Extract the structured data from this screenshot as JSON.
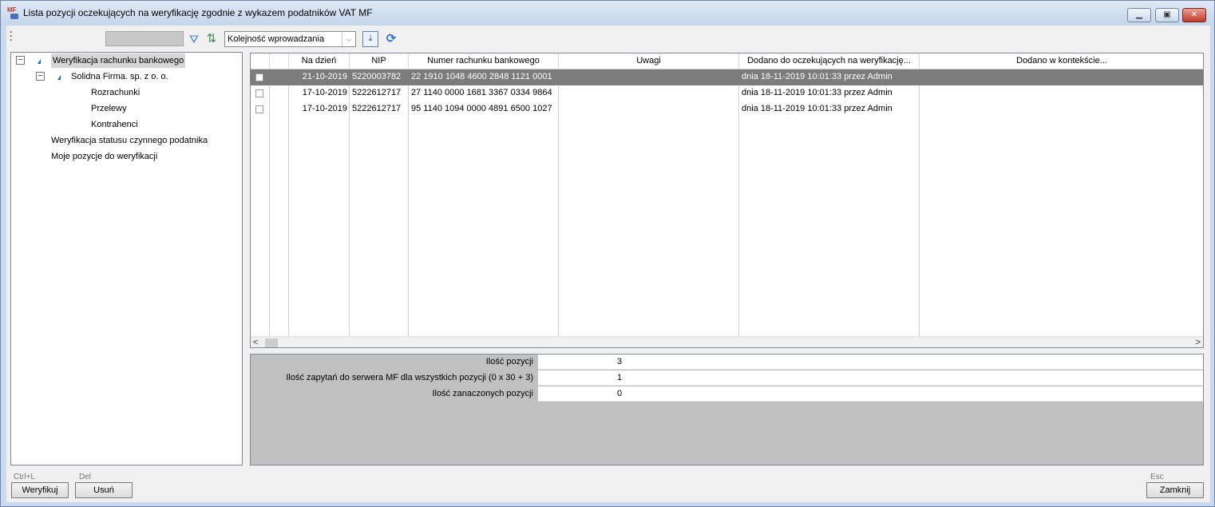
{
  "window": {
    "title": "Lista pozycji oczekujących na weryfikację zgodnie z wykazem podatników VAT MF",
    "icon_text": "MF"
  },
  "toolbar": {
    "search_value": "",
    "sort_combo_value": "Kolejność wprowadzania",
    "combo_arrow": "⌵",
    "refresh_glyph": "⟳"
  },
  "tree": {
    "items": [
      {
        "label": "Weryfikacja rachunku bankowego",
        "expander": "−",
        "selected": true
      },
      {
        "label": "Solidna Firma. sp. z o. o.",
        "expander": "−"
      },
      {
        "label": "Rozrachunki"
      },
      {
        "label": "Przelewy"
      },
      {
        "label": "Kontrahenci"
      },
      {
        "label": "Weryfikacja statusu czynnego podatnika"
      },
      {
        "label": "Moje pozycje do weryfikacji"
      }
    ]
  },
  "grid": {
    "columns": [
      "",
      "",
      "Na dzień",
      "NIP",
      "Numer rachunku bankowego",
      "Uwagi",
      "Dodano do oczekujących na weryfikację...",
      "Dodano w kontekście..."
    ],
    "rows": [
      {
        "date": "21-10-2019",
        "nip": "5220003782",
        "account": "22 1910 1048 4600 2848 1121 0001",
        "notes": "",
        "added": "dnia 18-11-2019  10:01:33 przez Admin",
        "context": "",
        "selected": true
      },
      {
        "date": "17-10-2019",
        "nip": "5222612717",
        "account": "27 1140 0000 1681 3367 0334 9864",
        "notes": "",
        "added": "dnia 18-11-2019  10:01:33 przez Admin",
        "context": ""
      },
      {
        "date": "17-10-2019",
        "nip": "5222612717",
        "account": "95 1140 1094 0000 4891 6500 1027",
        "notes": "",
        "added": "dnia 18-11-2019  10:01:33 przez Admin",
        "context": ""
      }
    ],
    "scroll_left": "<",
    "scroll_right": ">"
  },
  "summary": {
    "rows": [
      {
        "label": "Ilość pozycji",
        "value": "3"
      },
      {
        "label": "Ilość zapytań do serwera MF dla wszystkich pozycji (0 x 30 + 3)",
        "value": "1"
      },
      {
        "label": "Ilość zanaczonych pozycji",
        "value": "0"
      }
    ]
  },
  "footer": {
    "verify": {
      "shortcut": "Ctrl+L",
      "label": "Weryfikuj"
    },
    "delete": {
      "shortcut": "Del",
      "label": "Usuń"
    },
    "close": {
      "shortcut": "Esc",
      "label": "Zamknij"
    }
  },
  "colors": {
    "selected_row": "#7c7c7c",
    "tree_triangle": "#1c6fba",
    "summary_bg": "#c0c0c0"
  }
}
